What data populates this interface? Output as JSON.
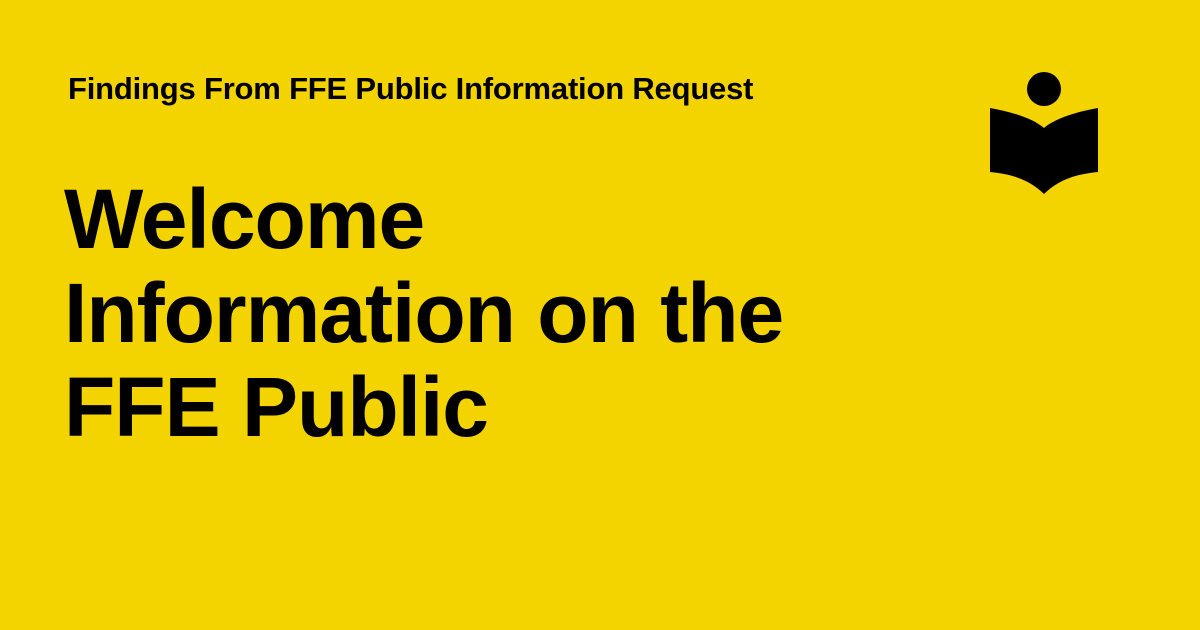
{
  "colors": {
    "background": "#f3d300",
    "text": "#000000"
  },
  "kicker": "Findings From FFE Public Information Request",
  "headline": {
    "lines": [
      "Welcome",
      "Information on the",
      "FFE Public"
    ]
  },
  "logo": {
    "icon": "reader-book-icon"
  }
}
